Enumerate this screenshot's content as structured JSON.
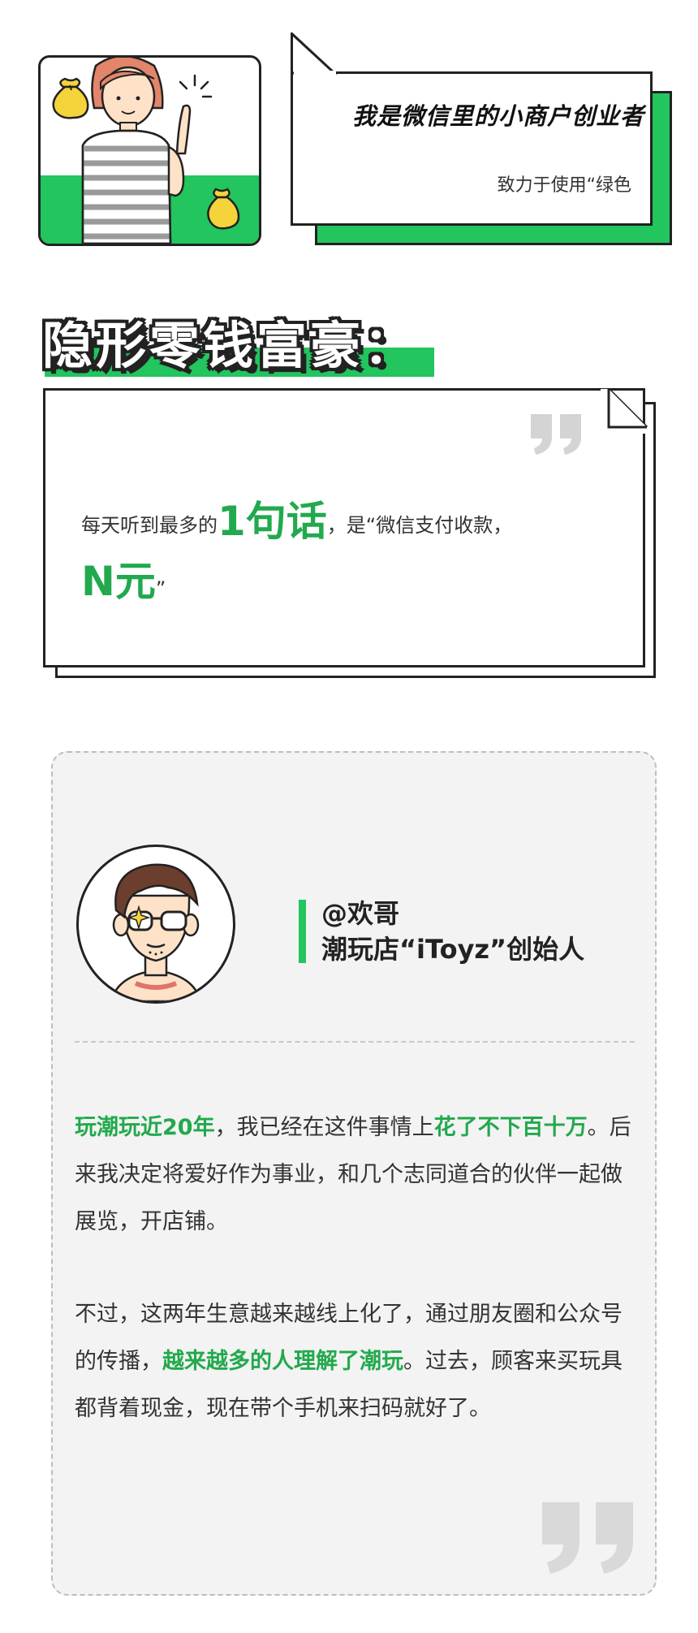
{
  "intro": {
    "title": "我是微信里的小商户创业者",
    "subtitle": "致力于使用“绿色"
  },
  "headline": "隐形零钱富豪：",
  "quote": {
    "before": "每天听到最多的",
    "emphasis1": "1句话",
    "after": "，是“微信支付收款，",
    "emphasis2": "N元",
    "end": "”"
  },
  "profile": {
    "handle": "@欢哥",
    "role": "潮玩店“iToyz”创始人",
    "para1": {
      "hl1": "玩潮玩近20年",
      "t1": "，我已经在这件事情上",
      "hl2": "花了不下百十万",
      "t2": "。后来我决定将爱好作为事业，和几个志同道合的伙伴一起做展览，开店铺。"
    },
    "para2": {
      "t1": "不过，这两年生意越来越线上化了，通过朋友圈和公众号的传播，",
      "hl1": "越来越多的人理解了潮玩",
      "t2": "。过去，顾客来买玩具都背着现金，现在带个手机来扫码就好了。"
    }
  },
  "colors": {
    "accent_green": "#22c55e",
    "text_green": "#22a94d",
    "dark": "#222222",
    "card_bg": "#f3f3f3"
  }
}
